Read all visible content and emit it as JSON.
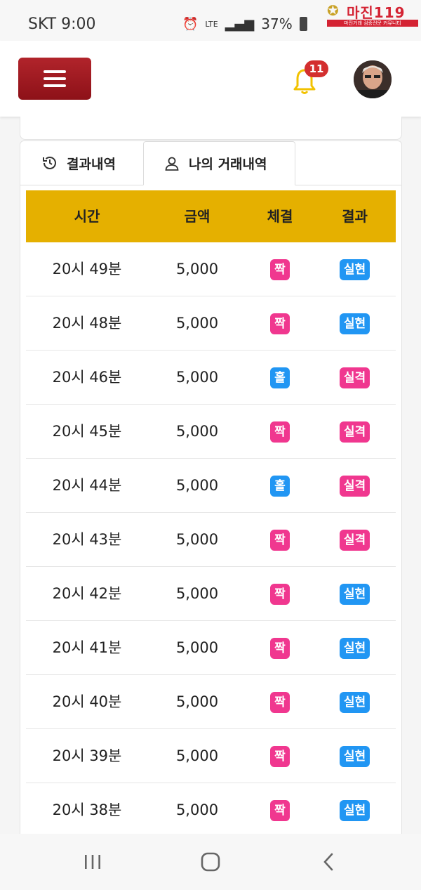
{
  "status_bar": {
    "carrier": "SKT 9:00",
    "network": "LTE",
    "battery": "37%"
  },
  "watermark": {
    "title": "마진119",
    "subtitle": "마진거래 검증전문 커뮤니티"
  },
  "header": {
    "notification_count": "11"
  },
  "tabs": [
    {
      "label": "결과내역",
      "icon": "history-icon",
      "active": false
    },
    {
      "label": "나의 거래내역",
      "icon": "user-icon",
      "active": true
    }
  ],
  "table": {
    "columns": [
      "시간",
      "금액",
      "체결",
      "결과"
    ],
    "rows": [
      {
        "time": "20시 49분",
        "amount": "5,000",
        "side": "짝",
        "result": "실현"
      },
      {
        "time": "20시 48분",
        "amount": "5,000",
        "side": "짝",
        "result": "실현"
      },
      {
        "time": "20시 46분",
        "amount": "5,000",
        "side": "홀",
        "result": "실격"
      },
      {
        "time": "20시 45분",
        "amount": "5,000",
        "side": "짝",
        "result": "실격"
      },
      {
        "time": "20시 44분",
        "amount": "5,000",
        "side": "홀",
        "result": "실격"
      },
      {
        "time": "20시 43분",
        "amount": "5,000",
        "side": "짝",
        "result": "실격"
      },
      {
        "time": "20시 42분",
        "amount": "5,000",
        "side": "짝",
        "result": "실현"
      },
      {
        "time": "20시 41분",
        "amount": "5,000",
        "side": "짝",
        "result": "실현"
      },
      {
        "time": "20시 40분",
        "amount": "5,000",
        "side": "짝",
        "result": "실현"
      },
      {
        "time": "20시 39분",
        "amount": "5,000",
        "side": "짝",
        "result": "실현"
      },
      {
        "time": "20시 38분",
        "amount": "5,000",
        "side": "짝",
        "result": "실현"
      }
    ]
  },
  "colors": {
    "header_bg": "#e5b000",
    "pink": "#f0378f",
    "blue": "#2196f3",
    "menu_red": "#a11b22",
    "bell_yellow": "#f2c200"
  }
}
